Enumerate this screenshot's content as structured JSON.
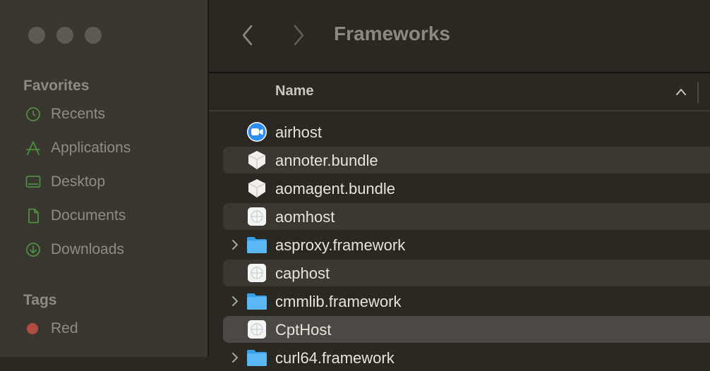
{
  "window": {
    "title": "Frameworks"
  },
  "sidebar": {
    "favorites_title": "Favorites",
    "favorites": [
      {
        "label": "Recents",
        "icon": "clock-icon"
      },
      {
        "label": "Applications",
        "icon": "applications-icon"
      },
      {
        "label": "Desktop",
        "icon": "desktop-icon"
      },
      {
        "label": "Documents",
        "icon": "document-icon"
      },
      {
        "label": "Downloads",
        "icon": "download-icon"
      }
    ],
    "tags_title": "Tags",
    "tags": [
      {
        "label": "Red",
        "color": "#b34b45"
      }
    ]
  },
  "columns": {
    "name": "Name",
    "sort": "ascending"
  },
  "files": [
    {
      "name": "airhost",
      "icon": "zoom-app-icon",
      "expandable": false
    },
    {
      "name": "annoter.bundle",
      "icon": "bundle-icon",
      "expandable": false
    },
    {
      "name": "aomagent.bundle",
      "icon": "bundle-icon",
      "expandable": false
    },
    {
      "name": "aomhost",
      "icon": "executable-icon",
      "expandable": false
    },
    {
      "name": "asproxy.framework",
      "icon": "folder-icon",
      "expandable": true
    },
    {
      "name": "caphost",
      "icon": "executable-icon",
      "expandable": false
    },
    {
      "name": "cmmlib.framework",
      "icon": "folder-icon",
      "expandable": true
    },
    {
      "name": "CptHost",
      "icon": "executable-icon",
      "expandable": false,
      "selected": true
    },
    {
      "name": "curl64.framework",
      "icon": "folder-icon",
      "expandable": true
    }
  ],
  "colors": {
    "folder": "#3aa0e8",
    "zoom_blue": "#2d8cff",
    "tag_red": "#b34b45"
  }
}
